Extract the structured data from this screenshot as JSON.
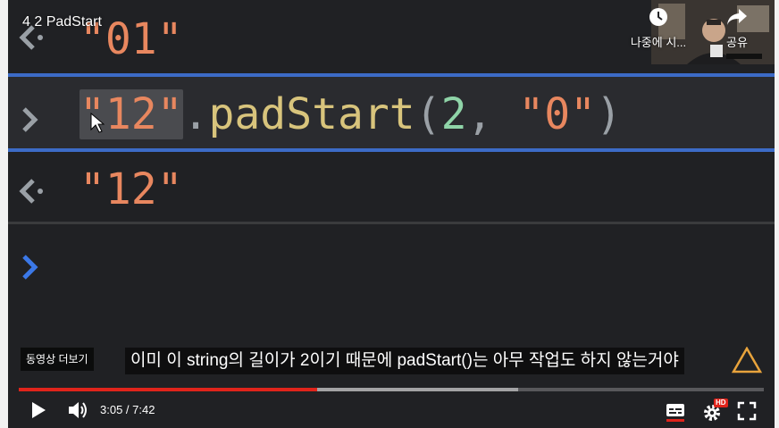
{
  "video": {
    "title": "4 2 PadStart",
    "watch_later_label": "나중에 시...",
    "share_label": "공유",
    "more_videos_label": "동영상 더보기",
    "subtitle": "이미 이 string의 길이가 2이기 때문에 padStart()는 아무 작업도 하지 않는거야",
    "time": "3:05 / 7:42",
    "progress_played": 0.4,
    "progress_buffered": 0.67,
    "hd_badge": "HD"
  },
  "console": {
    "previous_result": "\"01\"",
    "input_string": "\"12\"",
    "input_dot": ".",
    "input_method": "padStart",
    "input_open_paren": "(",
    "input_arg1": "2",
    "input_comma": ",",
    "input_arg2": "\"0\"",
    "input_close_paren": ")",
    "output_result": "\"12\""
  },
  "colors": {
    "string": "#e8875f",
    "number": "#8fd4a8",
    "method": "#d8c47c",
    "selection_border": "#3c6bc7",
    "progress": "#e0241b"
  },
  "icons": [
    "result-arrow-icon",
    "prompt-arrow-icon",
    "mouse-cursor-icon",
    "clock-icon",
    "share-icon",
    "play-icon",
    "volume-icon",
    "subtitles-icon",
    "settings-icon",
    "fullscreen-icon",
    "warning-icon"
  ]
}
